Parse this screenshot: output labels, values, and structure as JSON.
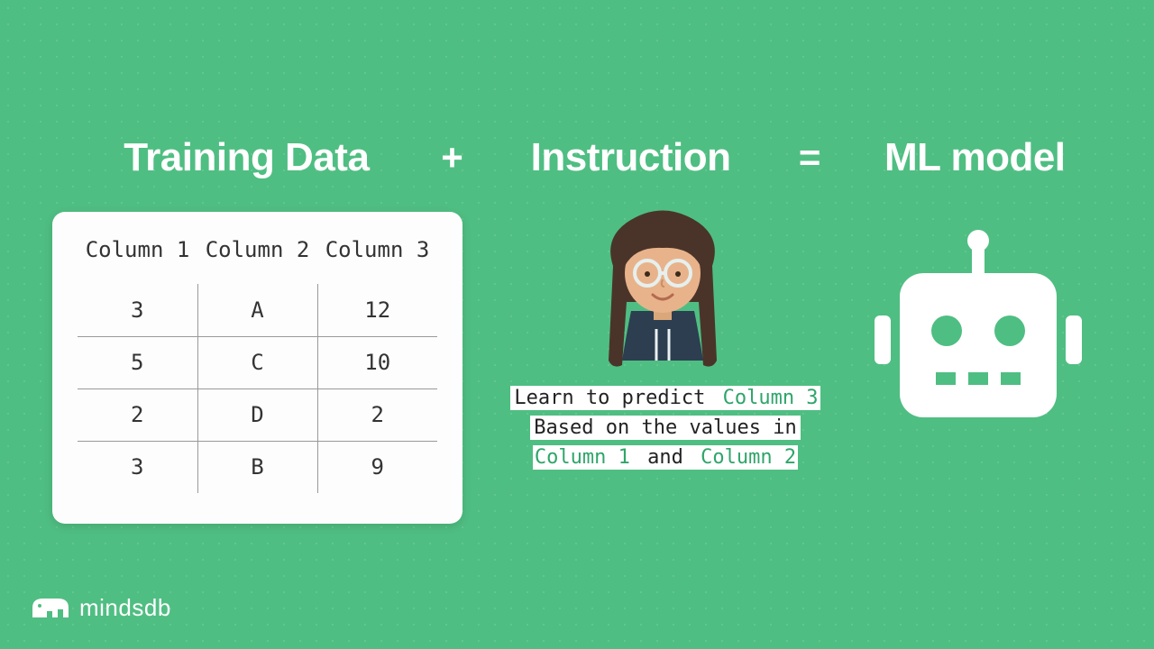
{
  "equation": {
    "training_data": "Training Data",
    "plus": "+",
    "instruction": "Instruction",
    "equals": "=",
    "model": "ML model"
  },
  "table": {
    "headers": [
      "Column 1",
      "Column 2",
      "Column 3"
    ],
    "rows": [
      [
        "3",
        "A",
        "12"
      ],
      [
        "5",
        "C",
        "10"
      ],
      [
        "2",
        "D",
        "2"
      ],
      [
        "3",
        "B",
        "9"
      ]
    ]
  },
  "instruction_text": {
    "l1a": "Learn to predict ",
    "l1b": "Column 3",
    "l2": "Based on the values in",
    "l3a": "Column 1",
    "l3mid": " and ",
    "l3b": "Column 2"
  },
  "logo": {
    "text": "mindsdb"
  },
  "icons": {
    "person": "person-illustration",
    "robot": "robot-icon",
    "bear": "bear-logo-icon"
  }
}
